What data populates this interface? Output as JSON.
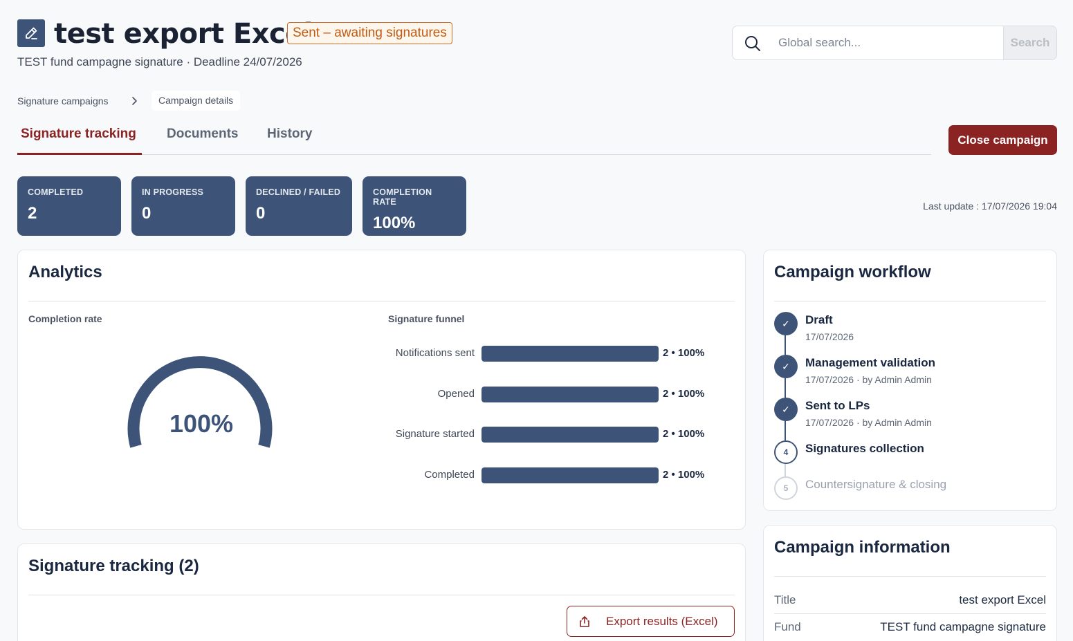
{
  "header": {
    "title": "test export Excel",
    "status": "Sent – awaiting signatures",
    "subtitle": "TEST fund campagne signature · Deadline 24/07/2026"
  },
  "search": {
    "placeholder": "Global search...",
    "button_label": "Search"
  },
  "breadcrumb": {
    "items": [
      "Signature campaigns",
      "Campaign details"
    ]
  },
  "tabs": [
    {
      "label": "Signature tracking",
      "active": true
    },
    {
      "label": "Documents",
      "active": false
    },
    {
      "label": "History",
      "active": false
    }
  ],
  "actions": {
    "close_campaign": "Close campaign"
  },
  "stats": [
    {
      "label": "COMPLETED",
      "value": "2"
    },
    {
      "label": "IN PROGRESS",
      "value": "0"
    },
    {
      "label": "DECLINED / FAILED",
      "value": "0"
    },
    {
      "label": "COMPLETION RATE",
      "value": "100%"
    }
  ],
  "last_update": "Last update : 17/07/2026 19:04",
  "analytics": {
    "title": "Analytics",
    "completion_label": "Completion rate",
    "completion_value": "100%",
    "completion_fraction": 1.0,
    "funnel_label": "Signature funnel",
    "funnel": [
      {
        "label": "Notifications sent",
        "value": "2 • 100%",
        "fraction": 1.0
      },
      {
        "label": "Opened",
        "value": "2 • 100%",
        "fraction": 1.0
      },
      {
        "label": "Signature started",
        "value": "2 • 100%",
        "fraction": 1.0
      },
      {
        "label": "Completed",
        "value": "2 • 100%",
        "fraction": 1.0
      }
    ]
  },
  "workflow": {
    "title": "Campaign workflow",
    "steps": [
      {
        "title": "Draft",
        "sub": "17/07/2026",
        "state": "done",
        "marker": "✓"
      },
      {
        "title": "Management validation",
        "sub": "17/07/2026 · by Admin Admin",
        "state": "done",
        "marker": "✓"
      },
      {
        "title": "Sent to LPs",
        "sub": "17/07/2026 · by Admin Admin",
        "state": "done",
        "marker": "✓"
      },
      {
        "title": "Signatures collection",
        "sub": "",
        "state": "current",
        "marker": "4"
      },
      {
        "title": "Countersignature & closing",
        "sub": "",
        "state": "future",
        "marker": "5"
      }
    ]
  },
  "tracking": {
    "title": "Signature tracking (2)",
    "export_label": "Export results (Excel)"
  },
  "info": {
    "title": "Campaign information",
    "rows": [
      {
        "key": "Title",
        "value": "test export Excel"
      },
      {
        "key": "Fund",
        "value": "TEST fund campagne signature"
      }
    ]
  },
  "colors": {
    "accent": "#8b2323",
    "primary": "#3d5478",
    "status": "#c25b12"
  }
}
